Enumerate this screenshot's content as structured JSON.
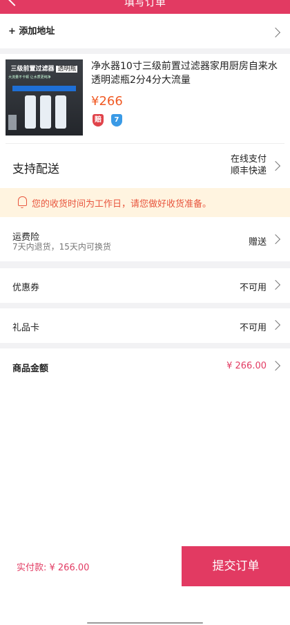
{
  "header": {
    "title": "填写订单"
  },
  "address": {
    "add_label": "+ 添加地址"
  },
  "product": {
    "title": "净水器10寸三级前置过滤器家用厨房自来水透明滤瓶2分4分大流量",
    "price": "¥266",
    "thumb_banner_main": "三级前置过滤器",
    "thumb_banner_tag": "透明瓶",
    "thumb_sub": "大流量不卡顿  让水质更纯净",
    "badges": [
      {
        "icon": "shield-red-icon",
        "text": "赔",
        "color": "#e0434a"
      },
      {
        "icon": "shield-blue-icon",
        "text": "7",
        "color": "#3a9ae6"
      }
    ]
  },
  "delivery": {
    "label": "支持配送",
    "payment": "在线支付",
    "courier": "顺丰快递"
  },
  "notice": {
    "text": "您的收货时间为工作日，请您做好收货准备。"
  },
  "freight_insurance": {
    "label": "运费险",
    "sub": "7天内退货，15天内可换货",
    "value": "赠送"
  },
  "coupon": {
    "label": "优惠券",
    "value": "不可用"
  },
  "gift_card": {
    "label": "礼品卡",
    "value": "不可用"
  },
  "amount": {
    "label": "商品金额",
    "value": "¥ 266.00"
  },
  "footer": {
    "pay_label": "实付款: ¥ 266.00",
    "submit_label": "提交订单"
  },
  "colors": {
    "accent": "#e23a62",
    "price": "#f05a24",
    "notice_bg": "#fff4e0"
  }
}
